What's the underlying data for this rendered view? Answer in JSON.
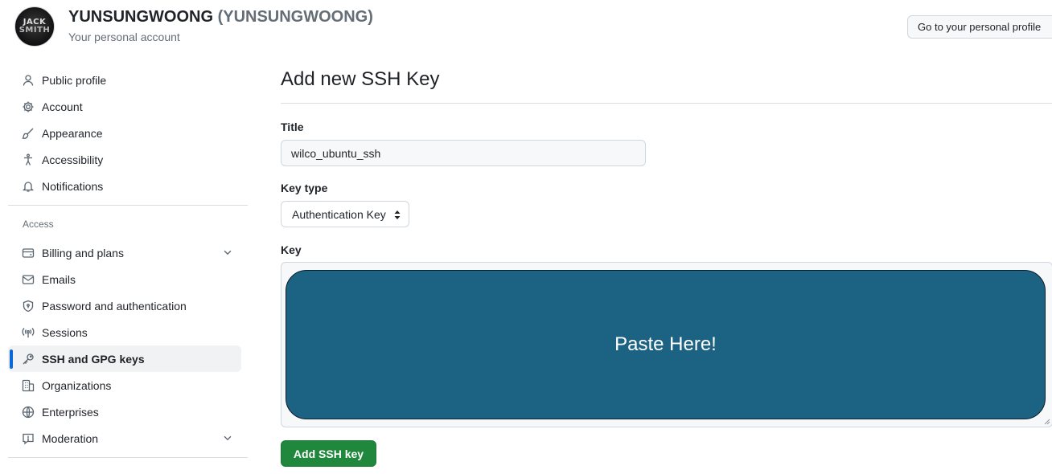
{
  "header": {
    "avatar_text_line1": "JACK",
    "avatar_text_line2": "SMITH",
    "username": "YUNSUNGWOONG",
    "login": "(YUNSUNGWOONG)",
    "subtitle": "Your personal account",
    "profile_button": "Go to your personal profile"
  },
  "sidebar": {
    "top_items": [
      {
        "label": "Public profile",
        "icon": "person-icon"
      },
      {
        "label": "Account",
        "icon": "gear-icon"
      },
      {
        "label": "Appearance",
        "icon": "paintbrush-icon"
      },
      {
        "label": "Accessibility",
        "icon": "accessibility-icon"
      },
      {
        "label": "Notifications",
        "icon": "bell-icon"
      }
    ],
    "section_label": "Access",
    "access_items": [
      {
        "label": "Billing and plans",
        "icon": "credit-card-icon"
      },
      {
        "label": "Emails",
        "icon": "mail-icon"
      },
      {
        "label": "Password and authentication",
        "icon": "shield-lock-icon"
      },
      {
        "label": "Sessions",
        "icon": "broadcast-icon"
      },
      {
        "label": "SSH and GPG keys",
        "icon": "key-icon",
        "active": true
      },
      {
        "label": "Organizations",
        "icon": "organization-icon"
      },
      {
        "label": "Enterprises",
        "icon": "globe-icon"
      },
      {
        "label": "Moderation",
        "icon": "report-icon"
      }
    ]
  },
  "main": {
    "title": "Add new SSH Key",
    "title_field_label": "Title",
    "title_field_value": "wilco_ubuntu_ssh",
    "key_type_label": "Key type",
    "key_type_value": "Authentication Key",
    "key_label": "Key",
    "paste_overlay_text": "Paste Here!",
    "submit_label": "Add SSH key"
  },
  "colors": {
    "accent": "#0969da",
    "primary_button": "#1f883d",
    "overlay": "#1b6283"
  }
}
